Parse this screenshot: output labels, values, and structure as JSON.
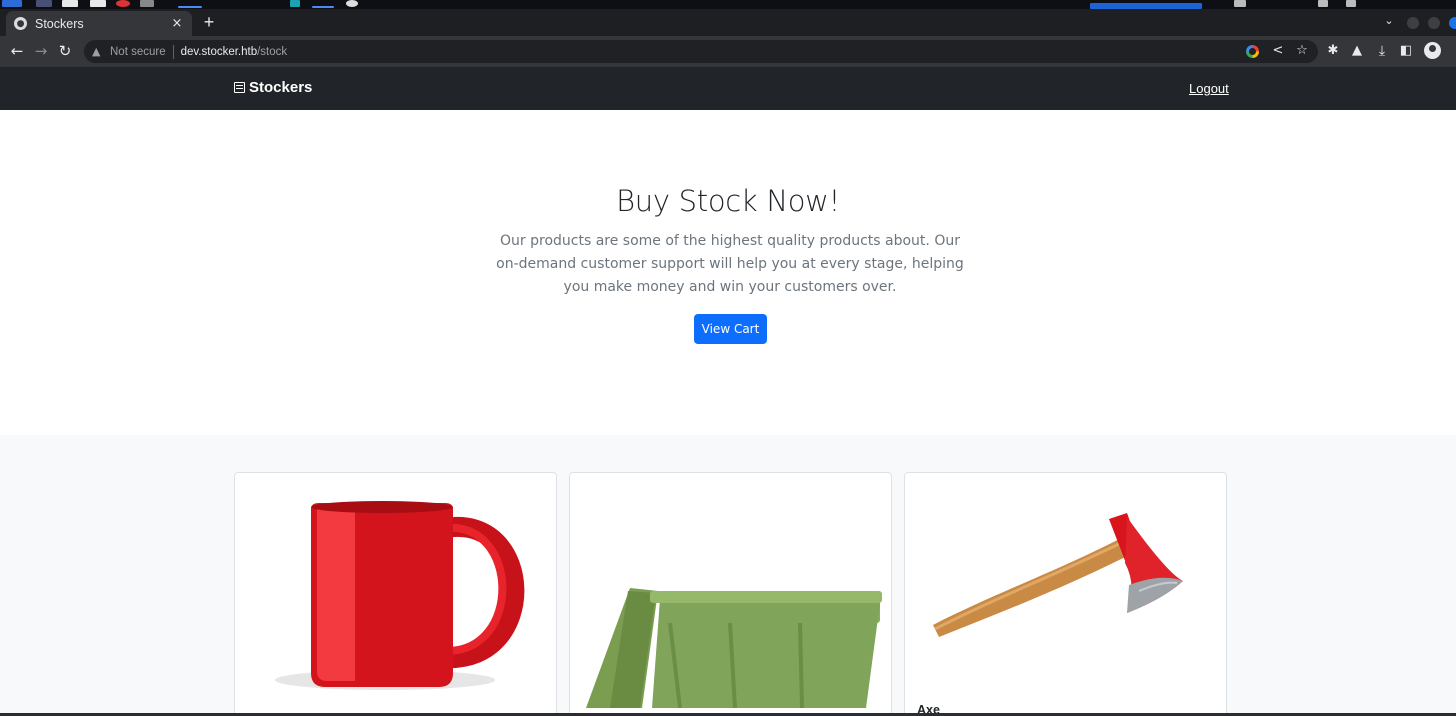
{
  "browser": {
    "tab": {
      "title": "Stockers",
      "close_glyph": "×"
    },
    "new_tab_glyph": "+",
    "address": {
      "security_label": "Not secure",
      "host": "dev.stocker.htb",
      "path": "/stock"
    },
    "nav_icons": [
      "back-arrow-icon",
      "forward-arrow-icon",
      "reload-icon"
    ],
    "toolbar_icons": [
      "google-lens-icon",
      "share-icon",
      "bookmark-star-icon",
      "extensions-icon",
      "labs-flask-icon",
      "download-icon",
      "side-panel-icon",
      "profile-avatar-icon"
    ]
  },
  "navbar": {
    "brand": "Stockers",
    "logout": "Logout"
  },
  "hero": {
    "title": "Buy Stock Now!",
    "lead": "Our products are some of the highest quality products about. Our on-demand customer support will help you at every stage, helping you make money and win your customers over.",
    "cta": "View Cart"
  },
  "products": [
    {
      "name": "",
      "image": "red-mug"
    },
    {
      "name": "",
      "image": "green-bin"
    },
    {
      "name": "Axe",
      "image": "axe"
    }
  ],
  "colors": {
    "navbar_bg": "#212529",
    "primary": "#0d6efd",
    "muted_text": "#6c757d",
    "section_bg": "#f8f9fa"
  }
}
